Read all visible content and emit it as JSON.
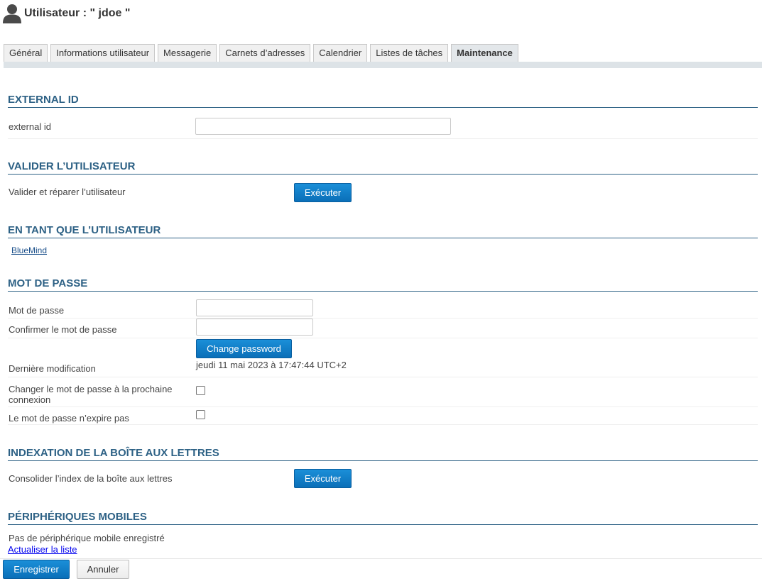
{
  "header": {
    "title": "Utilisateur : \" jdoe \"",
    "icon": "user-icon"
  },
  "tabs": [
    {
      "label": "Général",
      "active": false
    },
    {
      "label": "Informations utilisateur",
      "active": false
    },
    {
      "label": "Messagerie",
      "active": false
    },
    {
      "label": "Carnets d’adresses",
      "active": false
    },
    {
      "label": "Calendrier",
      "active": false
    },
    {
      "label": "Listes de tâches",
      "active": false
    },
    {
      "label": "Maintenance",
      "active": true
    }
  ],
  "external_id": {
    "title": "EXTERNAL ID",
    "field_label": "external id",
    "value": ""
  },
  "validate_user": {
    "title": "VALIDER L’UTILISATEUR",
    "label": "Valider et réparer l’utilisateur",
    "button": "Exécuter"
  },
  "as_user": {
    "title": "EN TANT QUE L’UTILISATEUR",
    "link": "BlueMind"
  },
  "password": {
    "title": "MOT DE PASSE",
    "password_label": "Mot de passe",
    "password_value": "",
    "confirm_label": "Confirmer le mot de passe",
    "confirm_value": "",
    "change_button": "Change password",
    "last_modified_label": "Dernière modification",
    "last_modified_value": "jeudi 11 mai 2023 à 17:47:44 UTC+2",
    "change_next_login_label_1": "Changer le mot de passe à la prochaine",
    "change_next_login_label_2": "connexion",
    "change_next_login_checked": false,
    "never_expires_label": "Le mot de passe n’expire pas",
    "never_expires_checked": false
  },
  "mailbox_index": {
    "title": "INDEXATION DE LA BOÎTE AUX LETTRES",
    "label": "Consolider l’index de la boîte aux lettres",
    "button": "Exécuter"
  },
  "mobile_devices": {
    "title": "PÉRIPHÉRIQUES MOBILES",
    "empty_text": "Pas de périphérique mobile enregistré",
    "refresh_link": "Actualiser la liste"
  },
  "footer": {
    "save_button": "Enregistrer",
    "cancel_button": "Annuler"
  },
  "colors": {
    "section_title": "#2d6185",
    "primary_button": "#0a6fb8",
    "tab_active_bg": "#e3e7ea"
  }
}
